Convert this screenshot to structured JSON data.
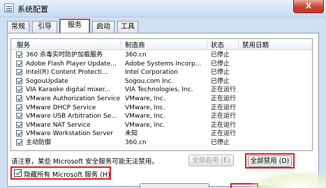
{
  "window": {
    "title": "系统配置",
    "close_glyph": "X"
  },
  "tabs": [
    {
      "label": "常规"
    },
    {
      "label": "引导"
    },
    {
      "label": "服务"
    },
    {
      "label": "启动"
    },
    {
      "label": "工具"
    }
  ],
  "table": {
    "headers": {
      "service": "服务",
      "manufacturer": "制造商",
      "status": "状态",
      "disabled_date": "禁用日期"
    },
    "rows": [
      {
        "checked": true,
        "service": "360 杀毒实时防护加载服务",
        "manufacturer": "360.cn",
        "status": "已停止"
      },
      {
        "checked": true,
        "service": "Adobe Flash Player Update...",
        "manufacturer": "Adobe Systems Incorp...",
        "status": "已停止"
      },
      {
        "checked": true,
        "service": "Intel(R) Content Protecti...",
        "manufacturer": "Intel Corporation",
        "status": "已停止"
      },
      {
        "checked": true,
        "service": "SogouUpdate",
        "manufacturer": "Sogou.com Inc.",
        "status": "已停止"
      },
      {
        "checked": true,
        "service": "VIA Karaoke digital mixer...",
        "manufacturer": "VIA Technologies, Inc.",
        "status": "正在运行"
      },
      {
        "checked": true,
        "service": "VMware Authorization Service",
        "manufacturer": "VMware, Inc.",
        "status": "正在运行"
      },
      {
        "checked": true,
        "service": "VMware DHCP Service",
        "manufacturer": "VMware, Inc.",
        "status": "正在运行"
      },
      {
        "checked": true,
        "service": "VMware USB Arbitration Se...",
        "manufacturer": "VMware, Inc.",
        "status": "正在运行"
      },
      {
        "checked": true,
        "service": "VMware NAT Service",
        "manufacturer": "VMware, Inc.",
        "status": "正在运行"
      },
      {
        "checked": true,
        "service": "VMware Workstation Server",
        "manufacturer": "未知",
        "status": "正在运行"
      },
      {
        "checked": true,
        "service": "主动防御",
        "manufacturer": "360.cn",
        "status": "已停止"
      }
    ]
  },
  "note": "请注意，某些 Microsoft 安全服务可能无法禁用。",
  "buttons": {
    "enable_all": "全部启用 (E)",
    "disable_all": "全部禁用 (D)"
  },
  "hide_ms": {
    "checked": true,
    "label": "隐藏所有 Microsoft 服务 (H)"
  },
  "colors": {
    "highlight": "#e0141b",
    "window_bg": "#cfe0f3",
    "close_button": "#c74431"
  }
}
